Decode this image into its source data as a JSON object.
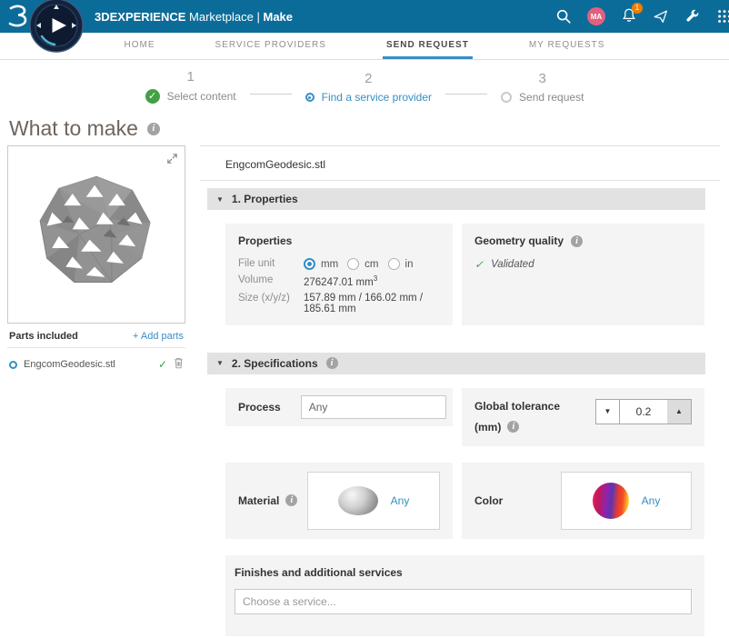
{
  "colors": {
    "header_bg": "#0c6c99",
    "accent_blue": "#368ec4",
    "green": "#43a047",
    "badge_bg": "#ef7d00",
    "avatar_bg": "#e0607e",
    "title_col": "#6e655c"
  },
  "header": {
    "brand": "3DEXPERIENCE",
    "app": "Marketplace",
    "separator": "|",
    "module": "Make",
    "avatar_initials": "MA",
    "notification_count": "1"
  },
  "nav": {
    "tabs": [
      {
        "label": "HOME"
      },
      {
        "label": "SERVICE PROVIDERS"
      },
      {
        "label": "SEND REQUEST"
      },
      {
        "label": "MY REQUESTS"
      }
    ]
  },
  "stepper": {
    "steps": [
      {
        "num": "1",
        "label": "Select content"
      },
      {
        "num": "2",
        "label": "Find a service provider"
      },
      {
        "num": "3",
        "label": "Send request"
      }
    ]
  },
  "page": {
    "title": "What to make"
  },
  "sidebar": {
    "parts_included": "Parts included",
    "add_parts": "+ Add parts",
    "parts": [
      {
        "name": "EngcomGeodesic.stl"
      }
    ]
  },
  "main": {
    "filename": "EngcomGeodesic.stl",
    "properties": {
      "section_title": "1. Properties",
      "panel_title": "Properties",
      "file_unit_label": "File unit",
      "units": [
        "mm",
        "cm",
        "in"
      ],
      "selected_unit": "mm",
      "volume_label": "Volume",
      "volume_value": "276247.01 mm",
      "volume_exponent": "3",
      "size_label": "Size (x/y/z)",
      "size_value": "157.89 mm / 166.02 mm / 185.61 mm",
      "geometry_title": "Geometry quality",
      "geometry_status": "Validated"
    },
    "specifications": {
      "section_title": "2. Specifications",
      "process_label": "Process",
      "process_value": "Any",
      "tolerance_label": "Global tolerance",
      "tolerance_unit": "(mm)",
      "tolerance_value": "0.2",
      "material_label": "Material",
      "material_value": "Any",
      "color_label": "Color",
      "color_value": "Any",
      "finishes_label": "Finishes and additional services",
      "finishes_placeholder": "Choose a service..."
    }
  }
}
